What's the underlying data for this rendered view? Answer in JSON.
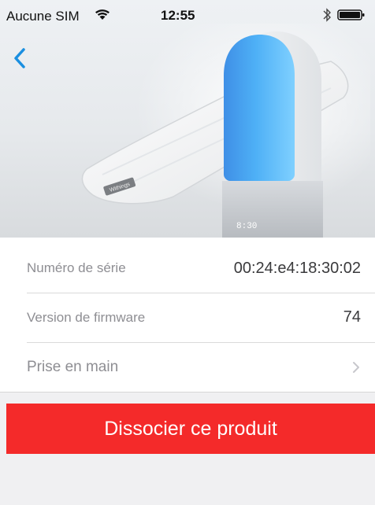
{
  "status_bar": {
    "carrier": "Aucune SIM",
    "time": "12:55",
    "icons": [
      "wifi-icon",
      "bluetooth-icon",
      "battery-icon"
    ]
  },
  "navigation": {
    "back_icon": "chevron-left-icon"
  },
  "product_image": {
    "clock_display": "8:30",
    "mat_brand": "Withings"
  },
  "details": {
    "rows": [
      {
        "label": "Numéro de série",
        "value": "00:24:e4:18:30:02"
      },
      {
        "label": "Version de firmware",
        "value": "74"
      },
      {
        "label": "Prise en main",
        "icon": "chevron-right-icon"
      }
    ]
  },
  "actions": {
    "dissociate_label": "Dissocier ce produit"
  },
  "colors": {
    "accent_blue": "#1a8fe0",
    "danger_red": "#f42a2a",
    "background": "#f0f0f2"
  }
}
